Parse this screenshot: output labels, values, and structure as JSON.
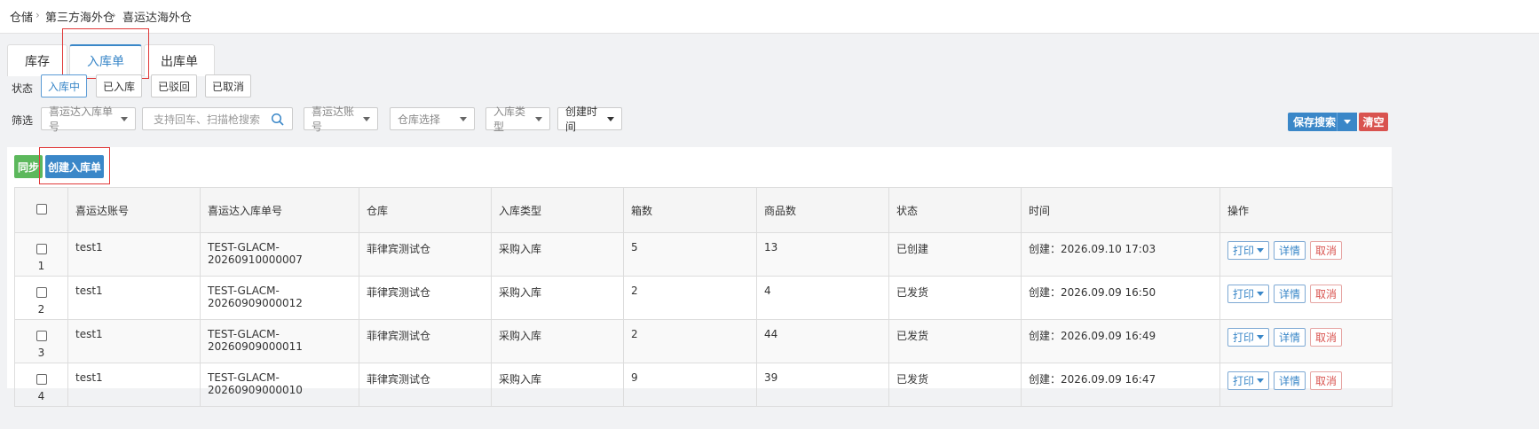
{
  "breadcrumb": [
    "仓储",
    "第三方海外仓",
    "喜运达海外仓"
  ],
  "tabs": [
    {
      "label": "库存",
      "active": false
    },
    {
      "label": "入库单",
      "active": true
    },
    {
      "label": "出库单",
      "active": false
    }
  ],
  "status": {
    "label": "状态",
    "buttons": [
      {
        "label": "入库中",
        "active": true
      },
      {
        "label": "已入库",
        "active": false
      },
      {
        "label": "已驳回",
        "active": false
      },
      {
        "label": "已取消",
        "active": false
      }
    ]
  },
  "filter": {
    "label": "筛选",
    "order_type_select": "喜运达入库单号",
    "search_placeholder": "支持回车、扫描枪搜索",
    "account_select": "喜运达账号",
    "warehouse_select": "仓库选择",
    "inbound_type_select": "入库类型",
    "time_select": "创建时间"
  },
  "actions": {
    "save_search": "保存搜索",
    "clear": "清空",
    "sync": "同步",
    "create": "创建入库单"
  },
  "colors": {
    "primary": "#3a87c8",
    "success": "#5cb85c",
    "danger": "#d9534f"
  },
  "table": {
    "headers": [
      "喜运达账号",
      "喜运达入库单号",
      "仓库",
      "入库类型",
      "箱数",
      "商品数",
      "状态",
      "时间",
      "操作"
    ],
    "rows": [
      {
        "num": "1",
        "account": "test1",
        "order_no": "TEST-GLACM-20260910000007",
        "warehouse": "菲律宾测试仓",
        "type": "采购入库",
        "boxes": "5",
        "items": "13",
        "status": "已创建",
        "time": "创建：2026.09.10 17:03"
      },
      {
        "num": "2",
        "account": "test1",
        "order_no": "TEST-GLACM-20260909000012",
        "warehouse": "菲律宾测试仓",
        "type": "采购入库",
        "boxes": "2",
        "items": "4",
        "status": "已发货",
        "time": "创建：2026.09.09 16:50"
      },
      {
        "num": "3",
        "account": "test1",
        "order_no": "TEST-GLACM-20260909000011",
        "warehouse": "菲律宾测试仓",
        "type": "采购入库",
        "boxes": "2",
        "items": "44",
        "status": "已发货",
        "time": "创建：2026.09.09 16:49"
      },
      {
        "num": "4",
        "account": "test1",
        "order_no": "TEST-GLACM-20260909000010",
        "warehouse": "菲律宾测试仓",
        "type": "采购入库",
        "boxes": "9",
        "items": "39",
        "status": "已发货",
        "time": "创建：2026.09.09 16:47"
      }
    ],
    "op_labels": {
      "print": "打印",
      "detail": "详情",
      "cancel": "取消"
    }
  }
}
